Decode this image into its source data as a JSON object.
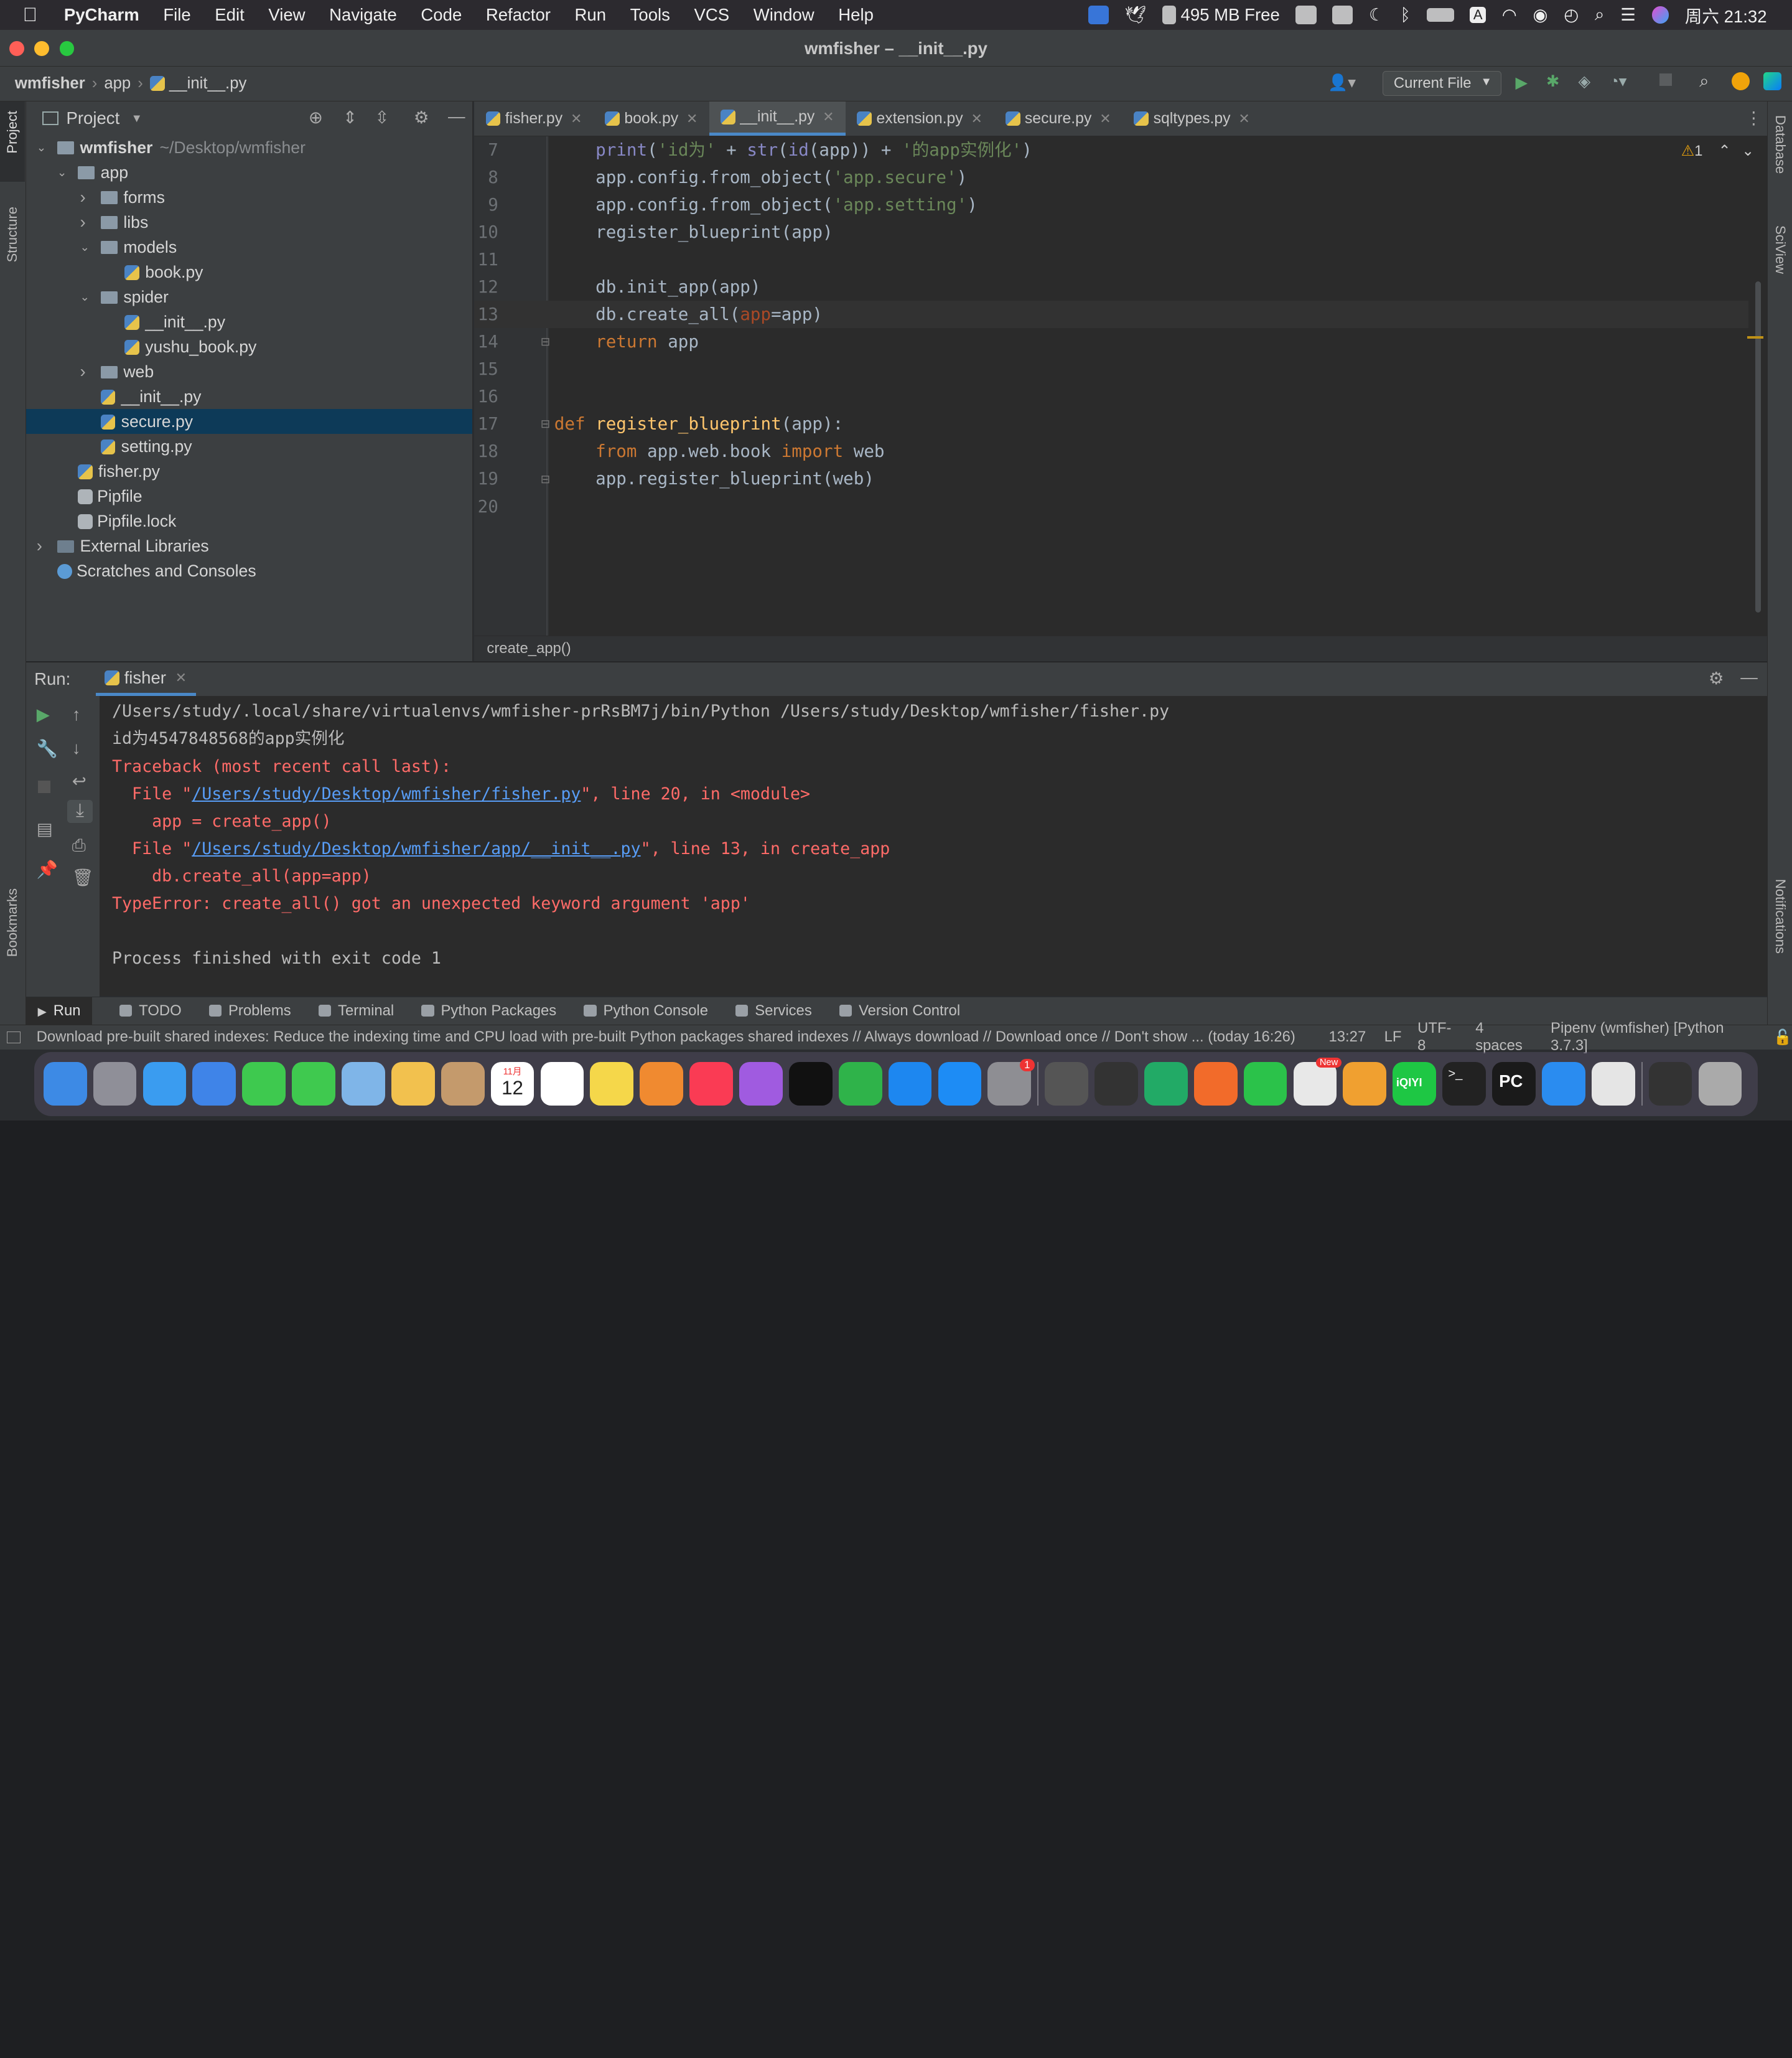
{
  "menubar": {
    "items": [
      "PyCharm",
      "File",
      "Edit",
      "View",
      "Navigate",
      "Code",
      "Refactor",
      "Run",
      "Tools",
      "VCS",
      "Window",
      "Help"
    ],
    "memory": "495 MB Free",
    "datetime": "周六 21:32"
  },
  "window": {
    "title": "wmfisher – __init__.py"
  },
  "navbar": {
    "crumbs": [
      "wmfisher",
      "app",
      "__init__.py"
    ],
    "run_config": "Current File"
  },
  "side_tabs": {
    "left_top": [
      "Project",
      "Structure"
    ],
    "left_bottom": "Bookmarks",
    "right_top": [
      "Database",
      "SciView"
    ],
    "right_bottom": "Notifications"
  },
  "project": {
    "header": "Project",
    "tree": [
      {
        "label": "wmfisher",
        "suffix": "~/Desktop/wmfisher",
        "depth": 0,
        "kind": "folder",
        "open": true
      },
      {
        "label": "app",
        "depth": 1,
        "kind": "folder",
        "open": true
      },
      {
        "label": "forms",
        "depth": 2,
        "kind": "folder",
        "open": false
      },
      {
        "label": "libs",
        "depth": 2,
        "kind": "folder",
        "open": false
      },
      {
        "label": "models",
        "depth": 2,
        "kind": "folder",
        "open": true
      },
      {
        "label": "book.py",
        "depth": 3,
        "kind": "py"
      },
      {
        "label": "spider",
        "depth": 2,
        "kind": "folder",
        "open": true
      },
      {
        "label": "__init__.py",
        "depth": 3,
        "kind": "py"
      },
      {
        "label": "yushu_book.py",
        "depth": 3,
        "kind": "py"
      },
      {
        "label": "web",
        "depth": 2,
        "kind": "folder",
        "open": false
      },
      {
        "label": "__init__.py",
        "depth": 2,
        "kind": "py"
      },
      {
        "label": "secure.py",
        "depth": 2,
        "kind": "py",
        "selected": true
      },
      {
        "label": "setting.py",
        "depth": 2,
        "kind": "py"
      },
      {
        "label": "fisher.py",
        "depth": 1,
        "kind": "py"
      },
      {
        "label": "Pipfile",
        "depth": 1,
        "kind": "file"
      },
      {
        "label": "Pipfile.lock",
        "depth": 1,
        "kind": "file"
      },
      {
        "label": "External Libraries",
        "depth": 0,
        "kind": "lib",
        "open": false
      },
      {
        "label": "Scratches and Consoles",
        "depth": 0,
        "kind": "scratch"
      }
    ]
  },
  "editor": {
    "tabs": [
      {
        "label": "fisher.py"
      },
      {
        "label": "book.py"
      },
      {
        "label": "__init__.py",
        "active": true
      },
      {
        "label": "extension.py"
      },
      {
        "label": "secure.py"
      },
      {
        "label": "sqltypes.py"
      }
    ],
    "warnings": "1",
    "lines": [
      {
        "n": "7",
        "tokens": [
          [
            "",
            "    "
          ],
          [
            "bi",
            "print"
          ],
          [
            "",
            "("
          ],
          [
            "st",
            "'id为'"
          ],
          [
            "",
            " + "
          ],
          [
            "bi",
            "str"
          ],
          [
            "",
            "("
          ],
          [
            "bi",
            "id"
          ],
          [
            "",
            "(app)) + "
          ],
          [
            "st",
            "'的app实例化'"
          ],
          [
            "",
            ")"
          ]
        ]
      },
      {
        "n": "8",
        "tokens": [
          [
            "",
            "    app.config.from_object("
          ],
          [
            "st",
            "'app.secure'"
          ],
          [
            "",
            ")"
          ]
        ]
      },
      {
        "n": "9",
        "tokens": [
          [
            "",
            "    app.config.from_object("
          ],
          [
            "st",
            "'app.setting'"
          ],
          [
            "",
            ")"
          ]
        ]
      },
      {
        "n": "10",
        "tokens": [
          [
            "",
            "    register_blueprint(app)"
          ]
        ]
      },
      {
        "n": "11",
        "tokens": []
      },
      {
        "n": "12",
        "tokens": [
          [
            "",
            "    db.init_app(app)"
          ]
        ]
      },
      {
        "n": "13",
        "tokens": [
          [
            "",
            "    db.create_all("
          ],
          [
            "pa",
            "app"
          ],
          [
            "",
            "=app)"
          ]
        ]
      },
      {
        "n": "14",
        "tokens": [
          [
            "kw",
            "    return"
          ],
          [
            "",
            " app"
          ]
        ]
      },
      {
        "n": "15",
        "tokens": []
      },
      {
        "n": "16",
        "tokens": []
      },
      {
        "n": "17",
        "tokens": [
          [
            "kw",
            "def "
          ],
          [
            "fn",
            "register_blueprint"
          ],
          [
            "",
            "(app):"
          ]
        ]
      },
      {
        "n": "18",
        "tokens": [
          [
            "kw",
            "    from"
          ],
          [
            "",
            " app.web.book "
          ],
          [
            "kw",
            "import"
          ],
          [
            "",
            " web"
          ]
        ]
      },
      {
        "n": "19",
        "tokens": [
          [
            "",
            "    app.register_blueprint(web)"
          ]
        ]
      },
      {
        "n": "20",
        "tokens": []
      }
    ],
    "breadcrumb": "create_app()"
  },
  "run": {
    "label": "Run:",
    "tab": "fisher",
    "output": [
      {
        "cls": "nrm",
        "parts": [
          {
            "t": "/Users/study/.local/share/virtualenvs/wmfisher-prRsBM7j/bin/Python /Users/study/Desktop/wmfisher/fisher.py"
          }
        ]
      },
      {
        "cls": "nrm",
        "parts": [
          {
            "t": "id为4547848568的app实例化"
          }
        ]
      },
      {
        "cls": "err",
        "parts": [
          {
            "t": "Traceback (most recent call last):"
          }
        ]
      },
      {
        "cls": "err",
        "parts": [
          {
            "t": "  File \""
          },
          {
            "t": "/Users/study/Desktop/wmfisher/fisher.py",
            "link": true
          },
          {
            "t": "\", line 20, in <module>"
          }
        ]
      },
      {
        "cls": "err",
        "parts": [
          {
            "t": "    app = create_app()"
          }
        ]
      },
      {
        "cls": "err",
        "parts": [
          {
            "t": "  File \""
          },
          {
            "t": "/Users/study/Desktop/wmfisher/app/__init__.py",
            "link": true
          },
          {
            "t": "\", line 13, in create_app"
          }
        ]
      },
      {
        "cls": "err",
        "parts": [
          {
            "t": "    db.create_all(app=app)"
          }
        ]
      },
      {
        "cls": "err",
        "parts": [
          {
            "t": "TypeError: create_all() got an unexpected keyword argument 'app'"
          }
        ]
      },
      {
        "cls": "nrm",
        "parts": [
          {
            "t": ""
          }
        ]
      },
      {
        "cls": "nrm",
        "parts": [
          {
            "t": "Process finished with exit code 1"
          }
        ]
      }
    ]
  },
  "toolwindows": [
    "Run",
    "TODO",
    "Problems",
    "Terminal",
    "Python Packages",
    "Python Console",
    "Services",
    "Version Control"
  ],
  "statusbar": {
    "message": "Download pre-built shared indexes: Reduce the indexing time and CPU load with pre-built Python packages shared indexes // Always download // Download once // Don't show ... (today 16:26)",
    "position": "13:27",
    "line_sep": "LF",
    "encoding": "UTF-8",
    "indent": "4 spaces",
    "interpreter": "Pipenv (wmfisher) [Python 3.7.3]"
  },
  "dock": {
    "apps": [
      "finder",
      "launchpad",
      "safari",
      "mail",
      "facetime",
      "messages",
      "maps",
      "photos",
      "contacts",
      "calendar",
      "reminders",
      "notes",
      "pages",
      "music",
      "podcasts",
      "tv",
      "numbers",
      "keynote",
      "app-store",
      "system-preferences",
      "screenshot",
      "photo-booth",
      "activity",
      "instruments",
      "wechat",
      "chrome",
      "books",
      "iqiyi",
      "terminal",
      "pycharm",
      "safari-2",
      "files",
      "monitor",
      "trash"
    ],
    "calendar_day": "12",
    "calendar_month": "11月",
    "settings_badge": "1",
    "chrome_badge": "New",
    "iqiyi_label": "iQIYI"
  },
  "colors": {
    "accent": "#4a88c7",
    "selection": "#0d3a58",
    "error": "#ff6b68",
    "link": "#589df6"
  }
}
